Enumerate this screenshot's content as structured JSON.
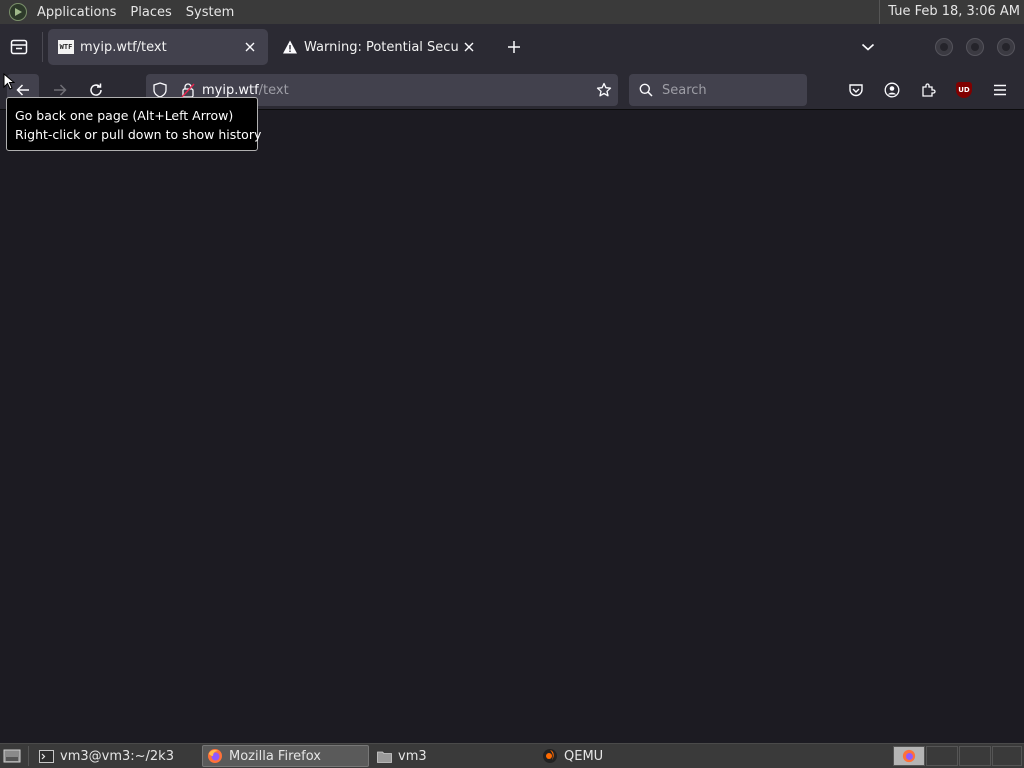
{
  "top_panel": {
    "menus": [
      "Applications",
      "Places",
      "System"
    ],
    "clock": "Tue Feb 18,  3:06 AM"
  },
  "tabs": [
    {
      "title": "myip.wtf/text",
      "favicon": "WTF"
    },
    {
      "title": "Warning: Potential Security"
    }
  ],
  "navbar": {
    "url_domain": "myip.wtf",
    "url_path": "/text",
    "search_placeholder": "Search"
  },
  "tooltip": {
    "line1": "Go back one page (Alt+Left Arrow)",
    "line2": "Right-click or pull down to show history"
  },
  "extensions": {
    "ublock_label": "UD"
  },
  "taskbar": {
    "tasks": [
      "vm3@vm3:~/2k3",
      "Mozilla Firefox",
      "vm3",
      "QEMU"
    ]
  },
  "colors": {
    "toolbar": "#2b2a33",
    "field": "#42414d",
    "content": "#1c1b22",
    "panel": "#3a3a3a"
  }
}
